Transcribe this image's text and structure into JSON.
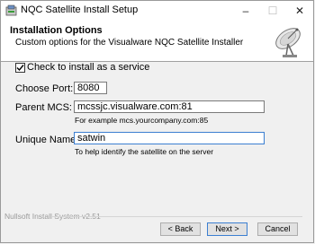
{
  "window": {
    "title": "NQC Satellite Install Setup"
  },
  "title_controls": {
    "minimize": "–",
    "maximize": "☐",
    "close": "✕"
  },
  "header": {
    "title": "Installation Options",
    "subtitle": "Custom options for the Visualware NQC Satellite Installer"
  },
  "service_checkbox": {
    "label": "Check to install as a service",
    "checked": true
  },
  "port": {
    "label": "Choose Port:",
    "value": "8080"
  },
  "parent_mcs": {
    "label": "Parent MCS:",
    "value": "mcssjc.visualware.com:81",
    "hint": "For example mcs.yourcompany.com:85"
  },
  "unique_name": {
    "label": "Unique Name:",
    "value": "satwin",
    "hint": "To help identify the satellite on the server"
  },
  "footer": {
    "branding": "Nullsoft Install System v2.51"
  },
  "buttons": {
    "back": "< Back",
    "next": "Next >",
    "cancel": "Cancel"
  },
  "colors": {
    "focus_border": "#3c7fd1",
    "window_bg": "#f0f0f0"
  }
}
